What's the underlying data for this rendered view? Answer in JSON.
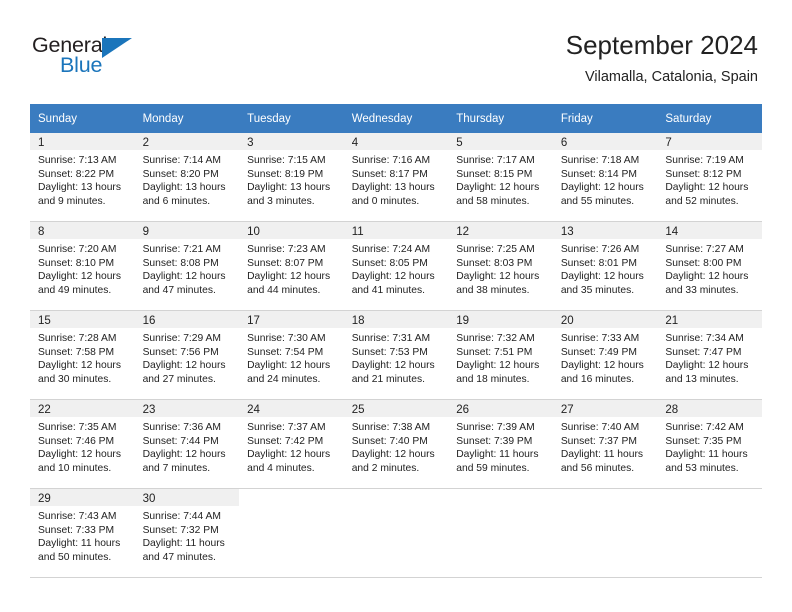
{
  "brand": {
    "name_part1": "General",
    "name_part2": "Blue",
    "accent_color": "#1b75bb"
  },
  "header": {
    "title": "September 2024",
    "location": "Vilamalla, Catalonia, Spain"
  },
  "theme": {
    "header_row_color": "#3a7cc0",
    "daynum_bg": "#f0f0f0",
    "text_color": "#222222"
  },
  "weekday_headers": [
    "Sunday",
    "Monday",
    "Tuesday",
    "Wednesday",
    "Thursday",
    "Friday",
    "Saturday"
  ],
  "weeks": [
    [
      {
        "day": "1",
        "sunrise": "Sunrise: 7:13 AM",
        "sunset": "Sunset: 8:22 PM",
        "daylight_line1": "Daylight: 13 hours",
        "daylight_line2": "and 9 minutes."
      },
      {
        "day": "2",
        "sunrise": "Sunrise: 7:14 AM",
        "sunset": "Sunset: 8:20 PM",
        "daylight_line1": "Daylight: 13 hours",
        "daylight_line2": "and 6 minutes."
      },
      {
        "day": "3",
        "sunrise": "Sunrise: 7:15 AM",
        "sunset": "Sunset: 8:19 PM",
        "daylight_line1": "Daylight: 13 hours",
        "daylight_line2": "and 3 minutes."
      },
      {
        "day": "4",
        "sunrise": "Sunrise: 7:16 AM",
        "sunset": "Sunset: 8:17 PM",
        "daylight_line1": "Daylight: 13 hours",
        "daylight_line2": "and 0 minutes."
      },
      {
        "day": "5",
        "sunrise": "Sunrise: 7:17 AM",
        "sunset": "Sunset: 8:15 PM",
        "daylight_line1": "Daylight: 12 hours",
        "daylight_line2": "and 58 minutes."
      },
      {
        "day": "6",
        "sunrise": "Sunrise: 7:18 AM",
        "sunset": "Sunset: 8:14 PM",
        "daylight_line1": "Daylight: 12 hours",
        "daylight_line2": "and 55 minutes."
      },
      {
        "day": "7",
        "sunrise": "Sunrise: 7:19 AM",
        "sunset": "Sunset: 8:12 PM",
        "daylight_line1": "Daylight: 12 hours",
        "daylight_line2": "and 52 minutes."
      }
    ],
    [
      {
        "day": "8",
        "sunrise": "Sunrise: 7:20 AM",
        "sunset": "Sunset: 8:10 PM",
        "daylight_line1": "Daylight: 12 hours",
        "daylight_line2": "and 49 minutes."
      },
      {
        "day": "9",
        "sunrise": "Sunrise: 7:21 AM",
        "sunset": "Sunset: 8:08 PM",
        "daylight_line1": "Daylight: 12 hours",
        "daylight_line2": "and 47 minutes."
      },
      {
        "day": "10",
        "sunrise": "Sunrise: 7:23 AM",
        "sunset": "Sunset: 8:07 PM",
        "daylight_line1": "Daylight: 12 hours",
        "daylight_line2": "and 44 minutes."
      },
      {
        "day": "11",
        "sunrise": "Sunrise: 7:24 AM",
        "sunset": "Sunset: 8:05 PM",
        "daylight_line1": "Daylight: 12 hours",
        "daylight_line2": "and 41 minutes."
      },
      {
        "day": "12",
        "sunrise": "Sunrise: 7:25 AM",
        "sunset": "Sunset: 8:03 PM",
        "daylight_line1": "Daylight: 12 hours",
        "daylight_line2": "and 38 minutes."
      },
      {
        "day": "13",
        "sunrise": "Sunrise: 7:26 AM",
        "sunset": "Sunset: 8:01 PM",
        "daylight_line1": "Daylight: 12 hours",
        "daylight_line2": "and 35 minutes."
      },
      {
        "day": "14",
        "sunrise": "Sunrise: 7:27 AM",
        "sunset": "Sunset: 8:00 PM",
        "daylight_line1": "Daylight: 12 hours",
        "daylight_line2": "and 33 minutes."
      }
    ],
    [
      {
        "day": "15",
        "sunrise": "Sunrise: 7:28 AM",
        "sunset": "Sunset: 7:58 PM",
        "daylight_line1": "Daylight: 12 hours",
        "daylight_line2": "and 30 minutes."
      },
      {
        "day": "16",
        "sunrise": "Sunrise: 7:29 AM",
        "sunset": "Sunset: 7:56 PM",
        "daylight_line1": "Daylight: 12 hours",
        "daylight_line2": "and 27 minutes."
      },
      {
        "day": "17",
        "sunrise": "Sunrise: 7:30 AM",
        "sunset": "Sunset: 7:54 PM",
        "daylight_line1": "Daylight: 12 hours",
        "daylight_line2": "and 24 minutes."
      },
      {
        "day": "18",
        "sunrise": "Sunrise: 7:31 AM",
        "sunset": "Sunset: 7:53 PM",
        "daylight_line1": "Daylight: 12 hours",
        "daylight_line2": "and 21 minutes."
      },
      {
        "day": "19",
        "sunrise": "Sunrise: 7:32 AM",
        "sunset": "Sunset: 7:51 PM",
        "daylight_line1": "Daylight: 12 hours",
        "daylight_line2": "and 18 minutes."
      },
      {
        "day": "20",
        "sunrise": "Sunrise: 7:33 AM",
        "sunset": "Sunset: 7:49 PM",
        "daylight_line1": "Daylight: 12 hours",
        "daylight_line2": "and 16 minutes."
      },
      {
        "day": "21",
        "sunrise": "Sunrise: 7:34 AM",
        "sunset": "Sunset: 7:47 PM",
        "daylight_line1": "Daylight: 12 hours",
        "daylight_line2": "and 13 minutes."
      }
    ],
    [
      {
        "day": "22",
        "sunrise": "Sunrise: 7:35 AM",
        "sunset": "Sunset: 7:46 PM",
        "daylight_line1": "Daylight: 12 hours",
        "daylight_line2": "and 10 minutes."
      },
      {
        "day": "23",
        "sunrise": "Sunrise: 7:36 AM",
        "sunset": "Sunset: 7:44 PM",
        "daylight_line1": "Daylight: 12 hours",
        "daylight_line2": "and 7 minutes."
      },
      {
        "day": "24",
        "sunrise": "Sunrise: 7:37 AM",
        "sunset": "Sunset: 7:42 PM",
        "daylight_line1": "Daylight: 12 hours",
        "daylight_line2": "and 4 minutes."
      },
      {
        "day": "25",
        "sunrise": "Sunrise: 7:38 AM",
        "sunset": "Sunset: 7:40 PM",
        "daylight_line1": "Daylight: 12 hours",
        "daylight_line2": "and 2 minutes."
      },
      {
        "day": "26",
        "sunrise": "Sunrise: 7:39 AM",
        "sunset": "Sunset: 7:39 PM",
        "daylight_line1": "Daylight: 11 hours",
        "daylight_line2": "and 59 minutes."
      },
      {
        "day": "27",
        "sunrise": "Sunrise: 7:40 AM",
        "sunset": "Sunset: 7:37 PM",
        "daylight_line1": "Daylight: 11 hours",
        "daylight_line2": "and 56 minutes."
      },
      {
        "day": "28",
        "sunrise": "Sunrise: 7:42 AM",
        "sunset": "Sunset: 7:35 PM",
        "daylight_line1": "Daylight: 11 hours",
        "daylight_line2": "and 53 minutes."
      }
    ],
    [
      {
        "day": "29",
        "sunrise": "Sunrise: 7:43 AM",
        "sunset": "Sunset: 7:33 PM",
        "daylight_line1": "Daylight: 11 hours",
        "daylight_line2": "and 50 minutes."
      },
      {
        "day": "30",
        "sunrise": "Sunrise: 7:44 AM",
        "sunset": "Sunset: 7:32 PM",
        "daylight_line1": "Daylight: 11 hours",
        "daylight_line2": "and 47 minutes."
      },
      {
        "day": "",
        "sunrise": "",
        "sunset": "",
        "daylight_line1": "",
        "daylight_line2": ""
      },
      {
        "day": "",
        "sunrise": "",
        "sunset": "",
        "daylight_line1": "",
        "daylight_line2": ""
      },
      {
        "day": "",
        "sunrise": "",
        "sunset": "",
        "daylight_line1": "",
        "daylight_line2": ""
      },
      {
        "day": "",
        "sunrise": "",
        "sunset": "",
        "daylight_line1": "",
        "daylight_line2": ""
      },
      {
        "day": "",
        "sunrise": "",
        "sunset": "",
        "daylight_line1": "",
        "daylight_line2": ""
      }
    ]
  ]
}
